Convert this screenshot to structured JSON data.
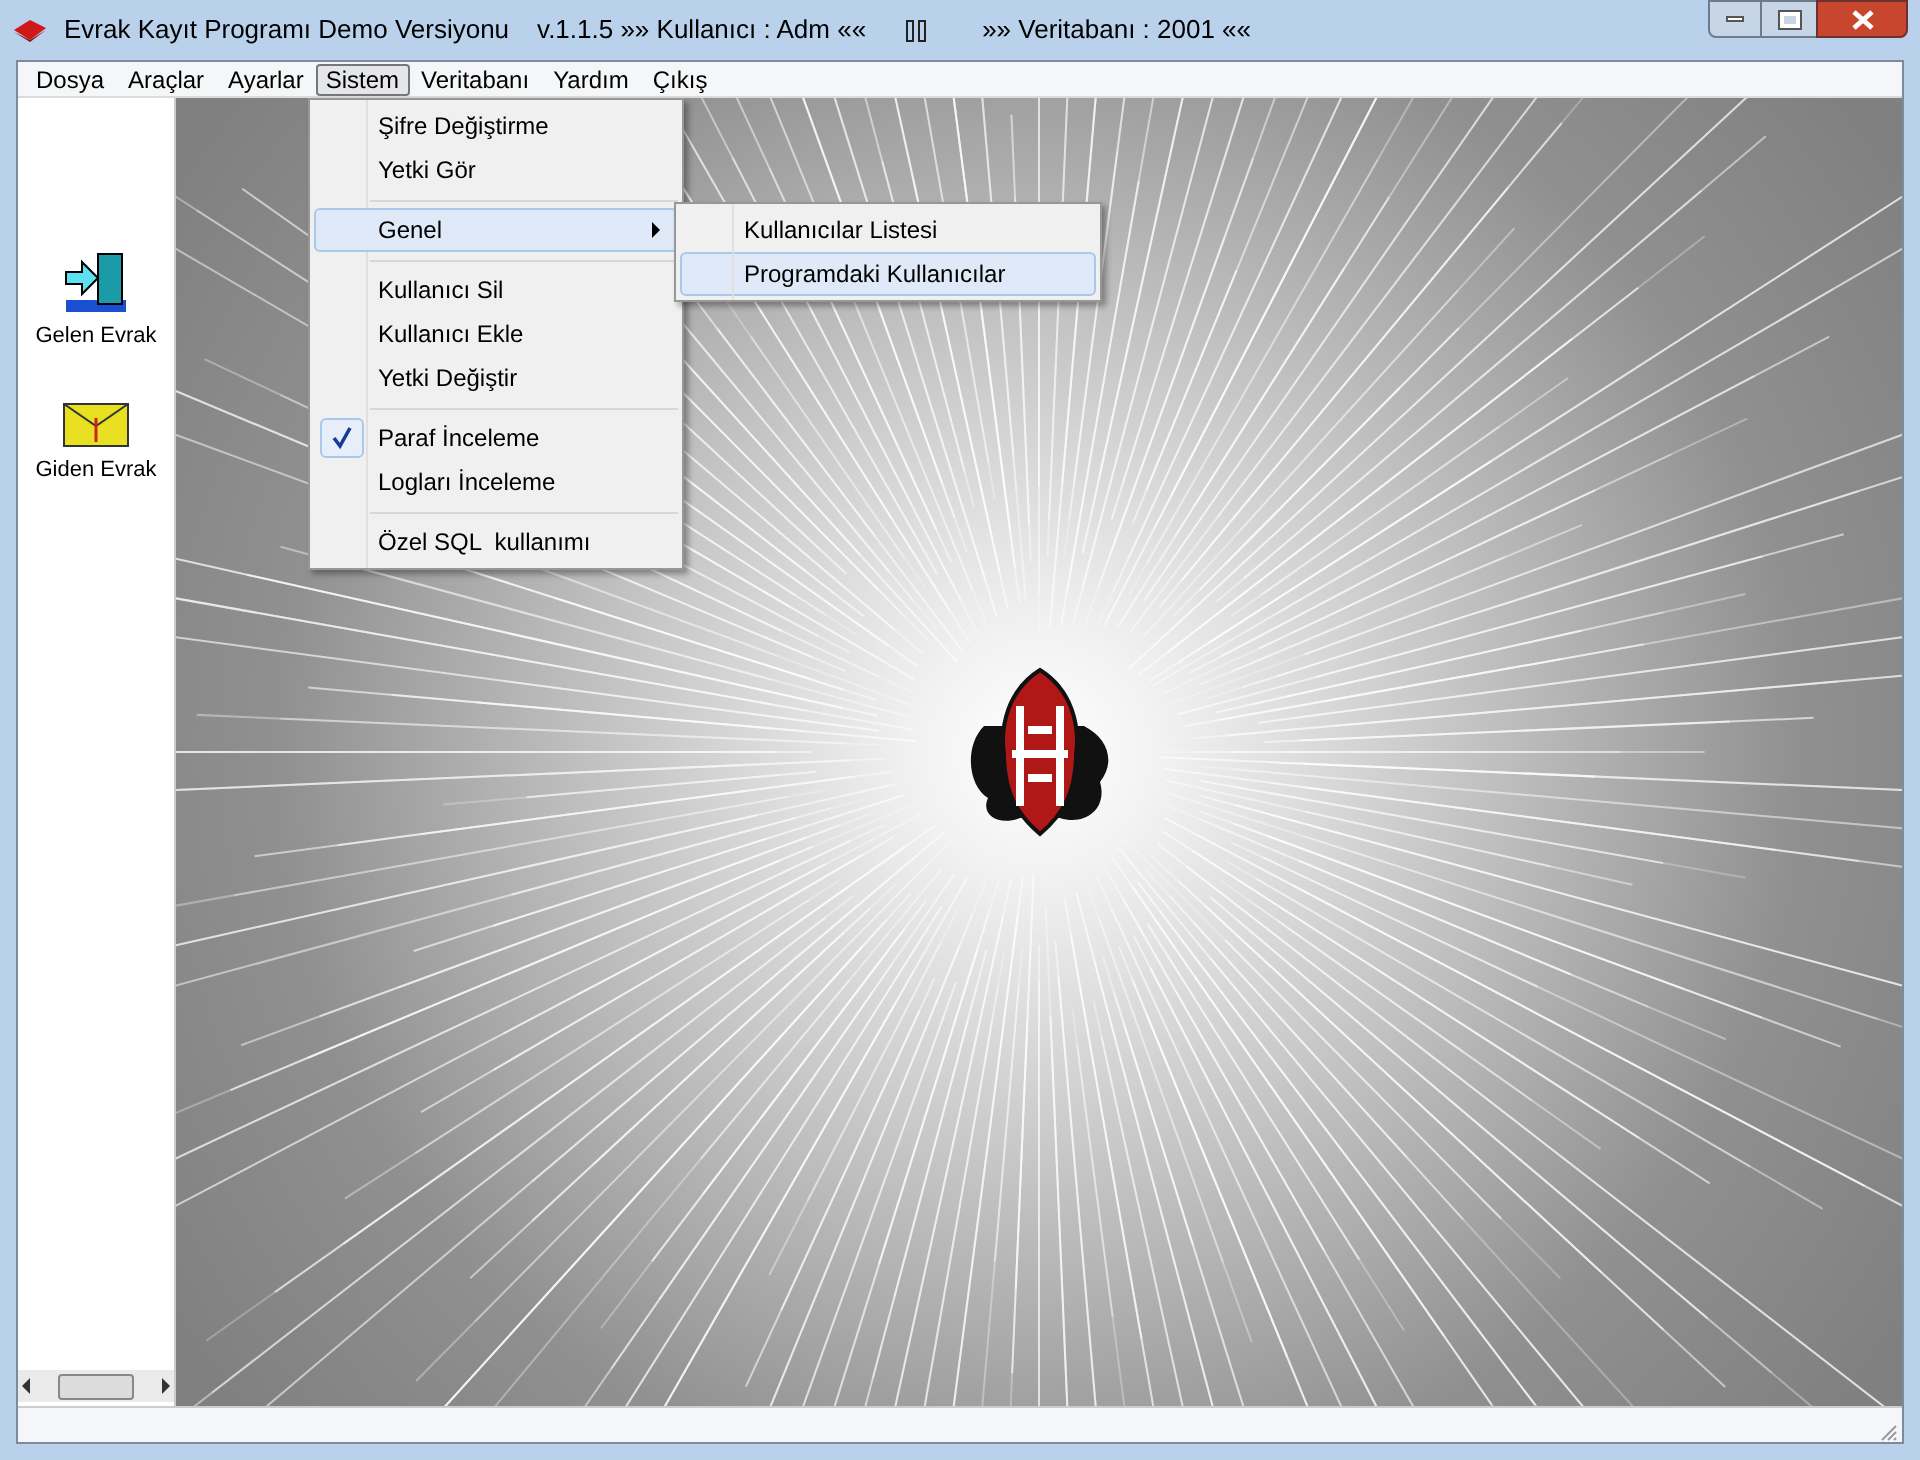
{
  "window": {
    "title_segments": [
      "Evrak Kayıt Programı Demo Versiyonu",
      "v.1.1.5 »»  Kullanıcı : Adm ««",
      "»»  Veritabanı : 2001 ««"
    ]
  },
  "menu_bar": [
    {
      "label": "Dosya",
      "selected": false
    },
    {
      "label": "Araçlar",
      "selected": false
    },
    {
      "label": "Ayarlar",
      "selected": false
    },
    {
      "label": "Sistem",
      "selected": true
    },
    {
      "label": "Veritabanı",
      "selected": false
    },
    {
      "label": "Yardım",
      "selected": false
    },
    {
      "label": "Çıkış",
      "selected": false
    }
  ],
  "dropdown": [
    {
      "kind": "item",
      "label": "Şifre Değiştirme",
      "checked": false,
      "selected": false
    },
    {
      "kind": "item",
      "label": "Yetki Gör",
      "checked": false,
      "selected": false
    },
    {
      "kind": "separator"
    },
    {
      "kind": "submenu",
      "label": "Genel",
      "checked": false,
      "selected": true
    },
    {
      "kind": "separator"
    },
    {
      "kind": "item",
      "label": "Kullanıcı Sil",
      "checked": false,
      "selected": false
    },
    {
      "kind": "item",
      "label": "Kullanıcı Ekle",
      "checked": false,
      "selected": false
    },
    {
      "kind": "item",
      "label": "Yetki Değiştir",
      "checked": false,
      "selected": false
    },
    {
      "kind": "separator"
    },
    {
      "kind": "item",
      "label": "Paraf İnceleme",
      "checked": true,
      "selected": false
    },
    {
      "kind": "item",
      "label": "Logları İnceleme",
      "checked": false,
      "selected": false
    },
    {
      "kind": "separator"
    },
    {
      "kind": "item",
      "label": "Özel SQL  kullanımı",
      "checked": false,
      "selected": false
    }
  ],
  "submenu": [
    {
      "label": "Kullanıcılar Listesi",
      "selected": false
    },
    {
      "label": "Programdaki Kullanıcılar",
      "selected": true
    }
  ],
  "sidebar": {
    "items": [
      {
        "kind": "incoming",
        "label": "Gelen Evrak"
      },
      {
        "kind": "outgoing",
        "label": "Giden Evrak"
      }
    ]
  }
}
